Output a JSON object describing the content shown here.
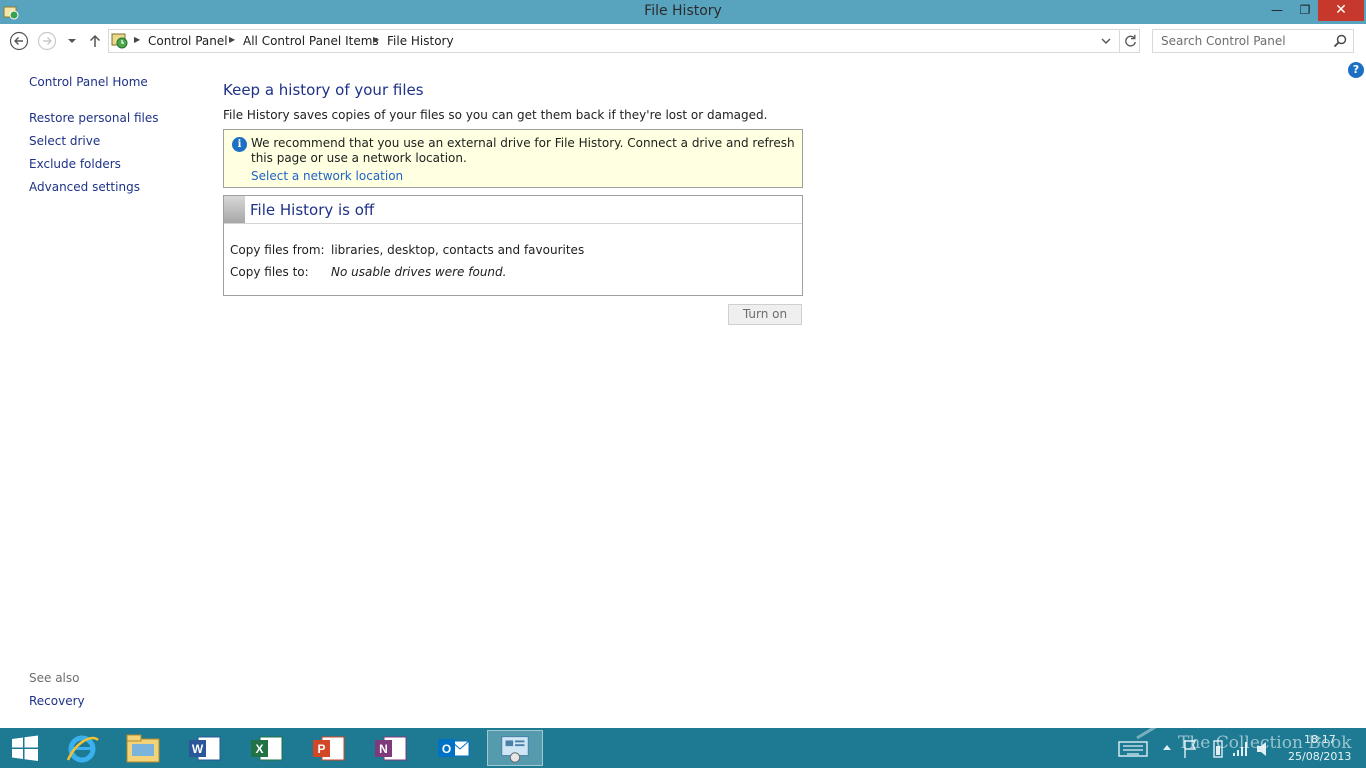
{
  "window": {
    "title": "File History",
    "minimize_glyph": "—",
    "maximize_glyph": "❐",
    "close_glyph": "✕"
  },
  "address": {
    "crumbs": [
      "Control Panel",
      "All Control Panel Items",
      "File History"
    ]
  },
  "search": {
    "placeholder": "Search Control Panel"
  },
  "sidebar": {
    "home": "Control Panel Home",
    "links": [
      "Restore personal files",
      "Select drive",
      "Exclude folders",
      "Advanced settings"
    ],
    "see_also_label": "See also",
    "see_also_links": [
      "Recovery"
    ]
  },
  "main": {
    "title": "Keep a history of your files",
    "description": "File History saves copies of your files so you can get them back if they're lost or damaged.",
    "info": {
      "message": "We recommend that you use an external drive for File History. Connect a drive and refresh this page or use a network location.",
      "link": "Select a network location"
    },
    "status": {
      "title": "File History is off",
      "rows": [
        {
          "label": "Copy files from:",
          "value": "libraries, desktop, contacts and favourites"
        },
        {
          "label": "Copy files to:",
          "value": "No usable drives were found."
        }
      ]
    },
    "turn_on_label": "Turn on"
  },
  "taskbar": {
    "apps": [
      "start",
      "internet-explorer",
      "file-explorer",
      "word",
      "excel",
      "powerpoint",
      "onenote",
      "outlook",
      "control-panel"
    ],
    "active_app": "control-panel",
    "watermark": "The Collection Book",
    "time": "18:17",
    "date": "25/08/2013"
  },
  "colors": {
    "titlebar": "#58a4bf",
    "taskbar": "#1d7a92",
    "link": "#1e3287",
    "info_bg": "#ffffe1",
    "close": "#c7382c"
  }
}
